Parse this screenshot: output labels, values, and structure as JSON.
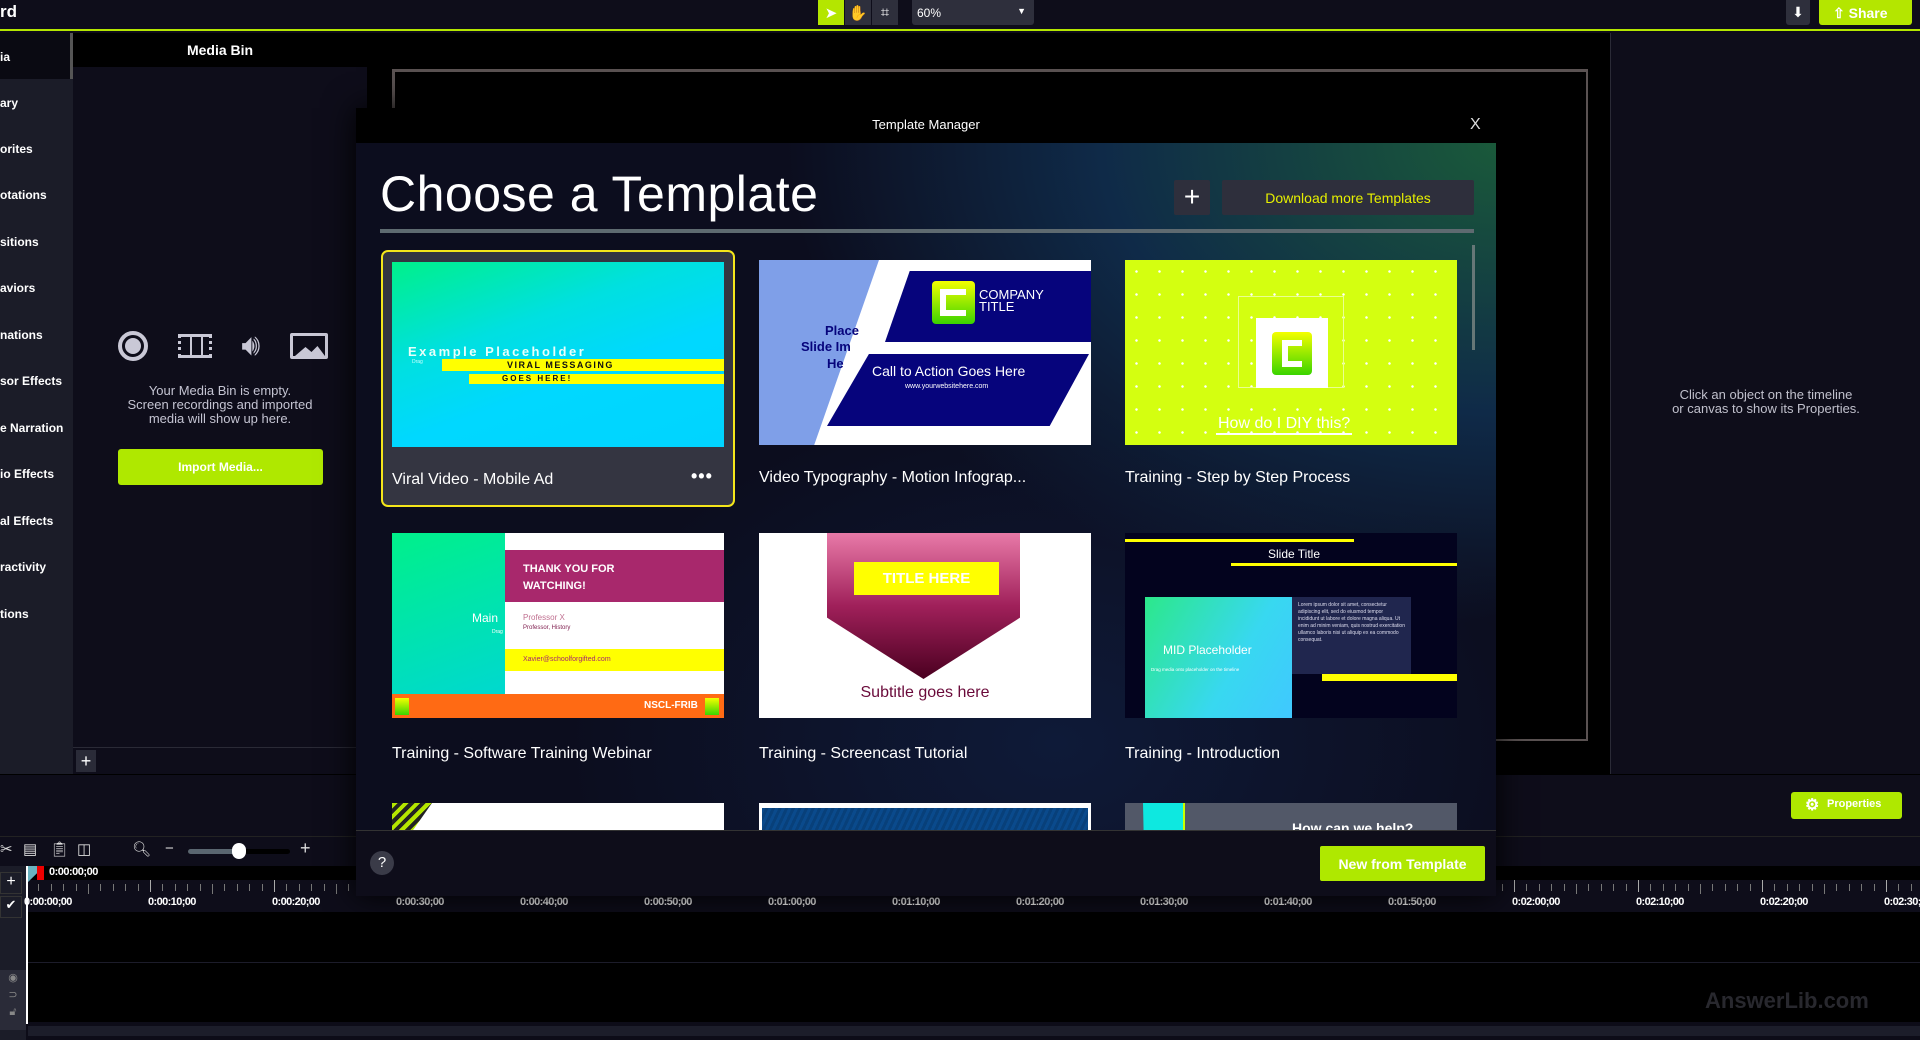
{
  "topbar": {
    "title_fragment": "rd",
    "zoom": "60%",
    "share": "Share",
    "tools": [
      "pointer-icon",
      "hand-icon",
      "crop-icon"
    ]
  },
  "sidebar": {
    "items": [
      "ia",
      "ary",
      "orites",
      "otations",
      "sitions",
      "aviors",
      "nations",
      "sor Effects",
      "e Narration",
      "io Effects",
      "al Effects",
      "ractivity",
      "tions"
    ]
  },
  "media_bin": {
    "title": "Media Bin",
    "empty_line1": "Your Media Bin is empty.",
    "empty_line2": "Screen recordings and imported",
    "empty_line3": "media will show up here.",
    "import": "Import Media..."
  },
  "properties": {
    "hint_line1": "Click an object on the timeline",
    "hint_line2": "or canvas to show its Properties.",
    "button": "Properties"
  },
  "modal": {
    "title": "Template Manager",
    "close": "X",
    "heading": "Choose a Template",
    "add": "+",
    "download": "Download more Templates",
    "new_from_template": "New from Template",
    "help": "?",
    "templates": [
      {
        "label": "Viral Video - Mobile Ad",
        "selected": true,
        "more": "•••",
        "thumb": {
          "line1": "Example Placeholder",
          "drag": "Drag",
          "bar1": "VIRAL MESSAGING",
          "bar2": "GOES HERE!"
        }
      },
      {
        "label": "Video Typography - Motion Infograp...",
        "thumb": {
          "company": "COMPANY",
          "title": "TITLE",
          "side1": "Place",
          "side2": "Slide Im",
          "side3": "He",
          "cta": "Call to Action Goes Here",
          "url": "www.yourwebsitehere.com"
        }
      },
      {
        "label": "Training - Step by Step Process",
        "thumb": {
          "question": "How do I DIY this?"
        }
      },
      {
        "label": "Training - Software Training Webinar",
        "thumb": {
          "thanks1": "THANK YOU FOR",
          "thanks2": "WATCHING!",
          "name": "Professor X",
          "role": "Professor, History",
          "email": "Xavier@schoolforgifted.com",
          "main": "Main",
          "drag": "Drag",
          "org": "NSCL-FRIB"
        }
      },
      {
        "label": "Training - Screencast Tutorial",
        "thumb": {
          "title": "TITLE HERE",
          "subtitle": "Subtitle goes here"
        }
      },
      {
        "label": "Training - Introduction",
        "thumb": {
          "slide_title": "Slide Title",
          "mid": "MID Placeholder",
          "drag": "Drag media onto placeholder on the timeline",
          "lorem": "Lorem ipsum dolor sit amet, consectetur adipiscing elit, sed do eiusmod tempor incididunt ut labore et dolore magna aliqua. Ut enim ad minim veniam, quis nostrud exercitation ullamco laboris nisi ut aliquip ex ea commodo consequat."
        }
      },
      {
        "label": "",
        "thumb": {}
      },
      {
        "label": "",
        "thumb": {}
      },
      {
        "label": "",
        "thumb": {
          "question": "How can we help?"
        }
      }
    ]
  },
  "timeline": {
    "playhead": "0:00:00;00",
    "labels": [
      "0:00:00;00",
      "0:00:10;00",
      "0:00:20;00",
      "0:00:30;00",
      "0:00:40;00",
      "0:00:50;00",
      "0:01:00;00",
      "0:01:10;00",
      "0:01:20;00",
      "0:01:30;00",
      "0:01:40;00",
      "0:01:50;00",
      "0:02:00;00",
      "0:02:10;00",
      "0:02:20;00",
      "0:02:30;00"
    ],
    "zoom_level": 0.5
  },
  "watermark": "AnswerLib.com",
  "colors": {
    "accent": "#afe800",
    "selection": "#f5e61a",
    "download_text": "#e6f000"
  }
}
